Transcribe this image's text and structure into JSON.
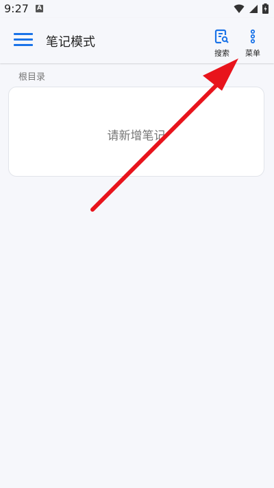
{
  "status_bar": {
    "time": "9:27",
    "notification_icon": "A"
  },
  "app_bar": {
    "title": "笔记模式",
    "menu_icon": "hamburger-menu-icon",
    "search_label": "搜索",
    "more_label": "菜单",
    "accent_color": "#1a73e8"
  },
  "main": {
    "section_label": "根目录",
    "empty_message": "请新增笔记"
  },
  "annotation": {
    "arrow_color": "#e8141c"
  }
}
